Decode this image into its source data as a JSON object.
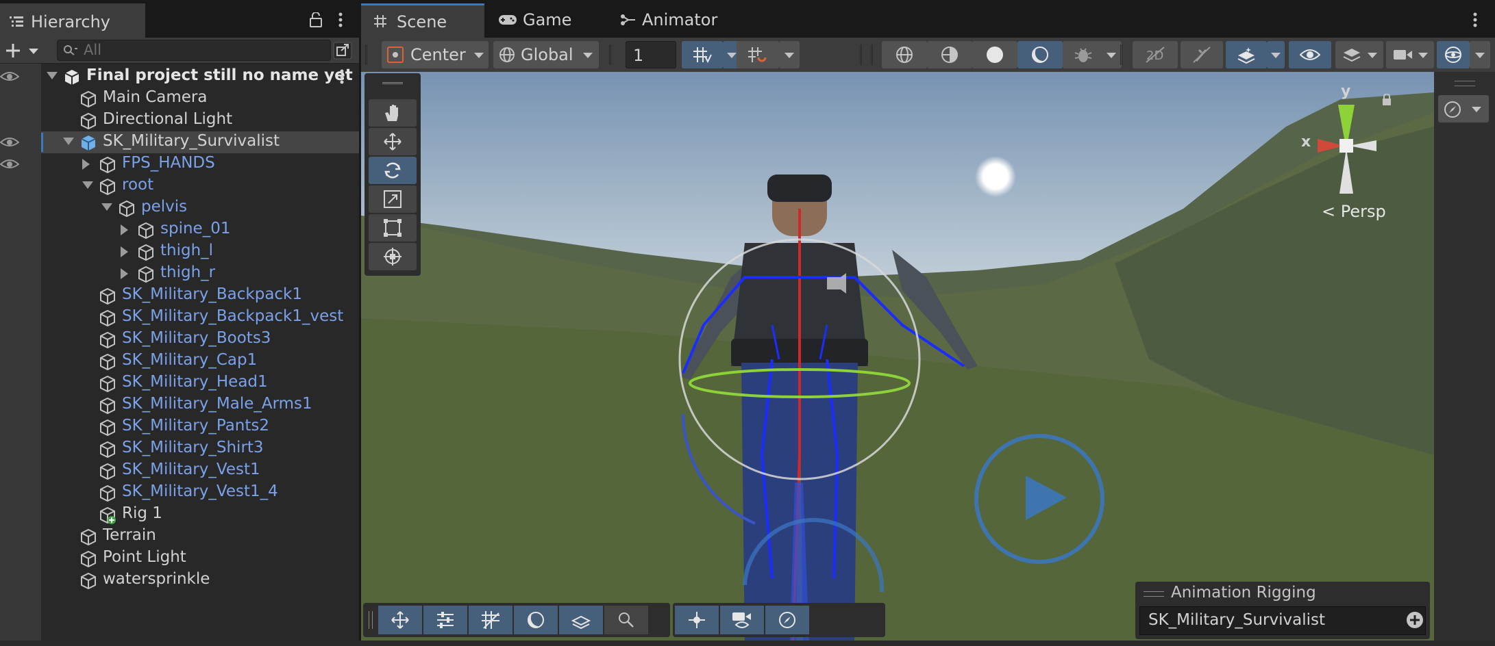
{
  "hierarchy": {
    "tab_label": "Hierarchy",
    "search_placeholder": "All",
    "items": [
      {
        "label": "Final project still no name yet",
        "style": "scene"
      },
      {
        "label": "Main Camera",
        "style": "white"
      },
      {
        "label": "Directional Light",
        "style": "white"
      },
      {
        "label": "SK_Military_Survivalist",
        "style": "white"
      },
      {
        "label": "FPS_HANDS",
        "style": "blue"
      },
      {
        "label": "root",
        "style": "blue"
      },
      {
        "label": "pelvis",
        "style": "blue"
      },
      {
        "label": "spine_01",
        "style": "blue"
      },
      {
        "label": "thigh_l",
        "style": "blue"
      },
      {
        "label": "thigh_r",
        "style": "blue"
      },
      {
        "label": "SK_Military_Backpack1",
        "style": "blue"
      },
      {
        "label": "SK_Military_Backpack1_vest",
        "style": "blue"
      },
      {
        "label": "SK_Military_Boots3",
        "style": "blue"
      },
      {
        "label": "SK_Military_Cap1",
        "style": "blue"
      },
      {
        "label": "SK_Military_Head1",
        "style": "blue"
      },
      {
        "label": "SK_Military_Male_Arms1",
        "style": "blue"
      },
      {
        "label": "SK_Military_Pants2",
        "style": "blue"
      },
      {
        "label": "SK_Military_Shirt3",
        "style": "blue"
      },
      {
        "label": "SK_Military_Vest1",
        "style": "blue"
      },
      {
        "label": "SK_Military_Vest1_4",
        "style": "blue"
      },
      {
        "label": "Rig 1",
        "style": "white"
      },
      {
        "label": "Terrain",
        "style": "white"
      },
      {
        "label": "Point Light",
        "style": "white"
      },
      {
        "label": "watersprinkle",
        "style": "white"
      }
    ]
  },
  "scene": {
    "tabs": [
      "Scene",
      "Game",
      "Animator"
    ],
    "pivot_label": "Center",
    "space_label": "Global",
    "grid_value": "1",
    "persp_label": "Persp",
    "axis_x": "x",
    "axis_y": "y",
    "overlay_title": "Animation Rigging",
    "overlay_value": "SK_Military_Survivalist"
  },
  "colors": {
    "accent": "#46607c",
    "prefab_blue": "#7ba1e8"
  }
}
